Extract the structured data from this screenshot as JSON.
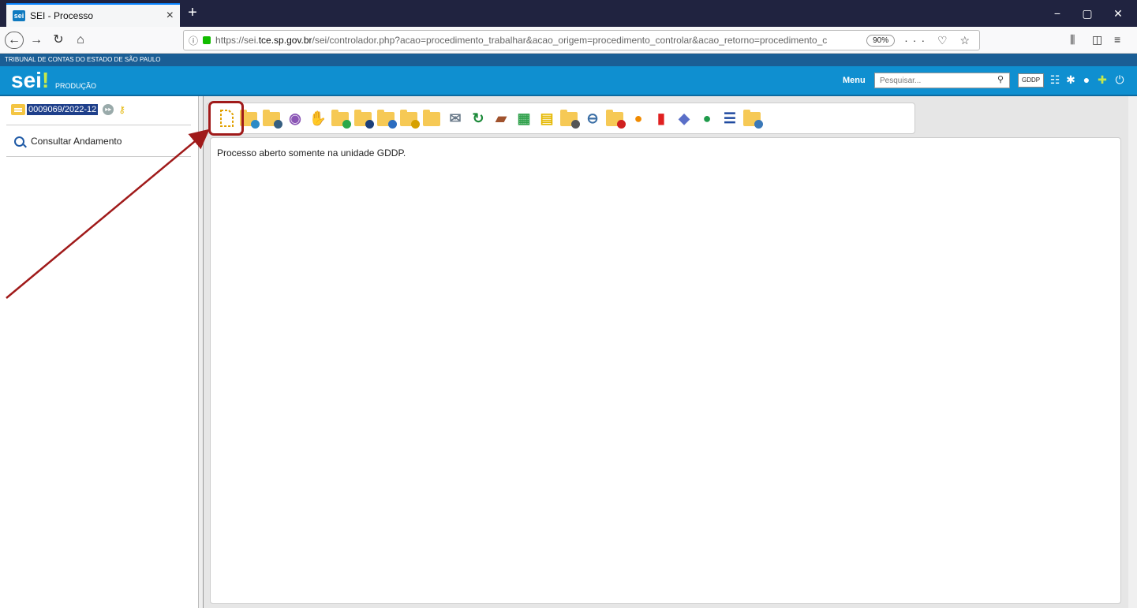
{
  "browser": {
    "tab_title": "SEI - Processo",
    "tab_favicon": "sei",
    "tab_close": "×",
    "new_tab": "+",
    "url_prefix": "https://sei.",
    "url_domain": "tce.sp.gov.br",
    "url_rest": "/sei/controlador.php?acao=procedimento_trabalhar&acao_origem=procedimento_controlar&acao_retorno=procedimento_c",
    "zoom": "90%"
  },
  "sei": {
    "org_name": "TRIBUNAL DE CONTAS DO ESTADO DE SÃO PAULO",
    "logo_text": "sei",
    "logo_mark": "!",
    "environment": "PRODUÇÃO",
    "menu_label": "Menu",
    "search_placeholder": "Pesquisar...",
    "unit": "GDDP"
  },
  "tree": {
    "process_number": "0009069/2022-12",
    "consult_label": "Consultar Andamento"
  },
  "content": {
    "message": "Processo aberto somente na unidade GDDP."
  },
  "colors": {
    "header_blue": "#0f8fd0",
    "strip_blue": "#1a5e95",
    "folder_yellow": "#f6c955",
    "highlight_red": "#a01a1a"
  },
  "toolbar_icons": [
    "include-document-icon",
    "relate-process-icon",
    "process-settings-icon",
    "view-icon",
    "sign-icon",
    "send-process-icon",
    "process-info-icon",
    "assign-user-icon",
    "favorite-process-icon",
    "folder-icon",
    "email-icon",
    "refresh-icon",
    "add-block-icon",
    "add-unit-icon",
    "annotation-icon",
    "suspend-process-icon",
    "link-icon",
    "close-process-icon",
    "comment-icon",
    "delete-icon",
    "tag-icon",
    "deadline-icon",
    "list-icon",
    "search-folder-icon"
  ]
}
